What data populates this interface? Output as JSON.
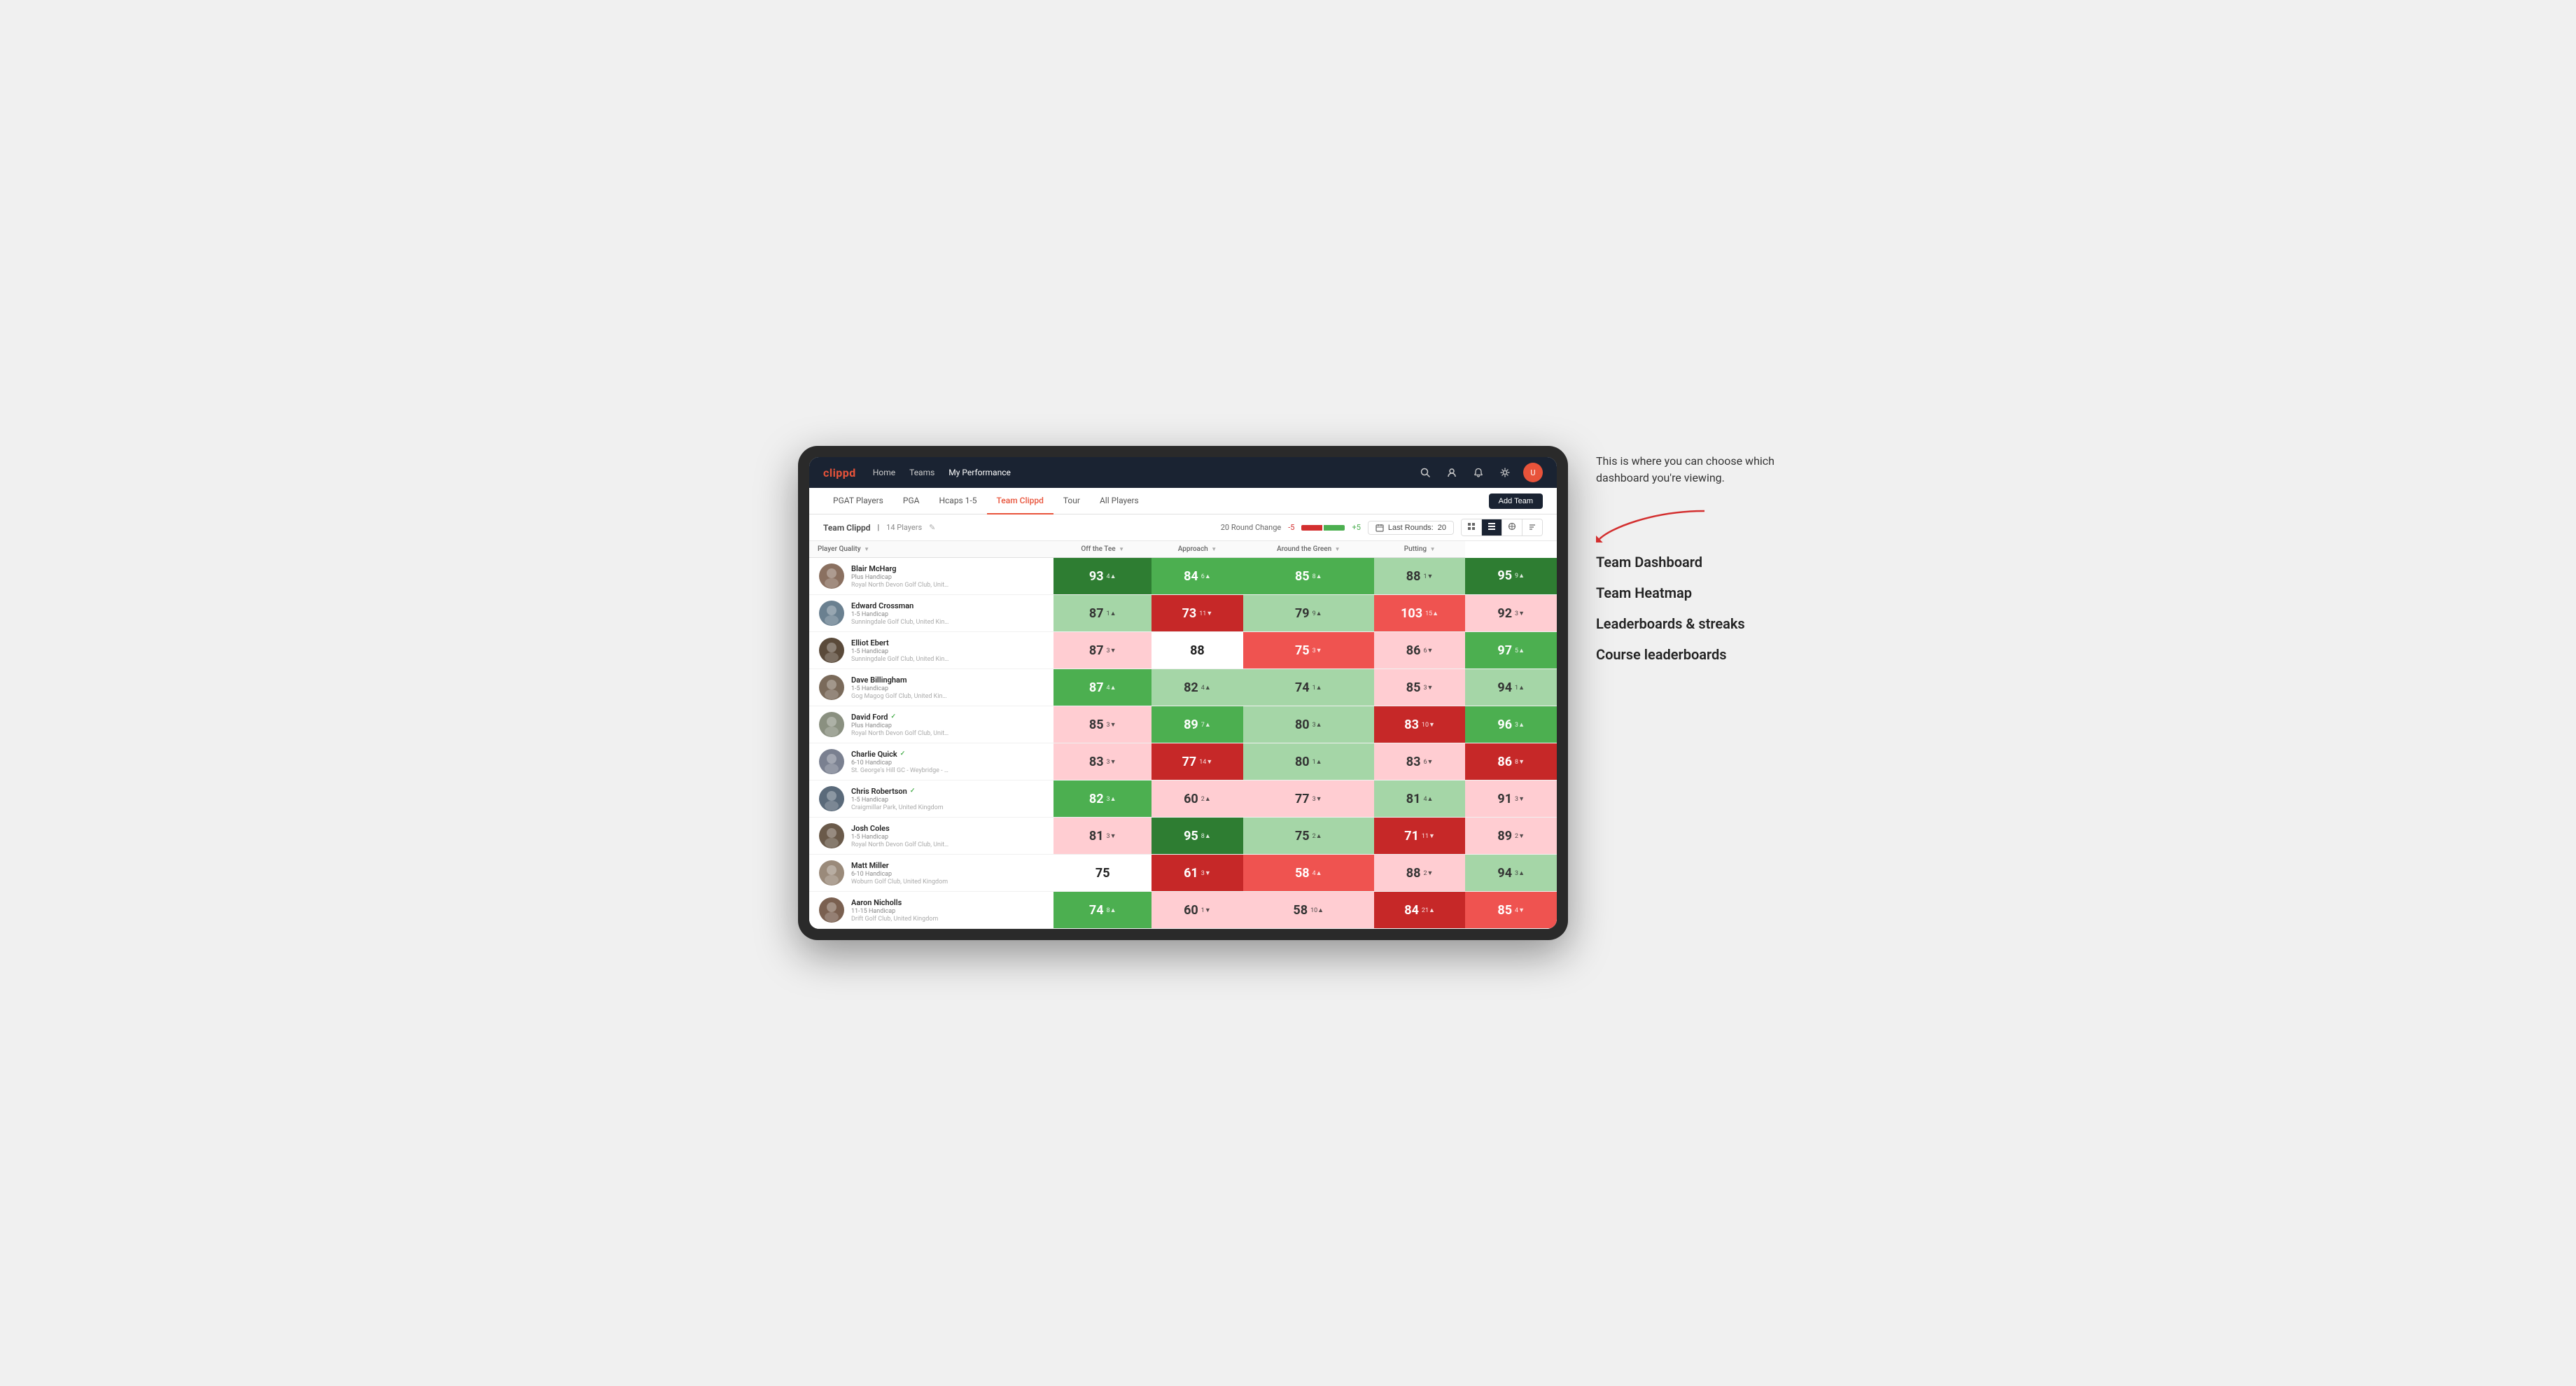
{
  "annotation": {
    "intro_text": "This is where you can choose which dashboard you're viewing.",
    "items": [
      {
        "label": "Team Dashboard"
      },
      {
        "label": "Team Heatmap"
      },
      {
        "label": "Leaderboards & streaks"
      },
      {
        "label": "Course leaderboards"
      }
    ]
  },
  "app": {
    "logo": "clippd",
    "nav": {
      "links": [
        {
          "label": "Home",
          "active": false
        },
        {
          "label": "Teams",
          "active": false
        },
        {
          "label": "My Performance",
          "active": true
        }
      ]
    },
    "sub_tabs": [
      {
        "label": "PGAT Players",
        "active": false
      },
      {
        "label": "PGA",
        "active": false
      },
      {
        "label": "Hcaps 1-5",
        "active": false
      },
      {
        "label": "Team Clippd",
        "active": true
      },
      {
        "label": "Tour",
        "active": false
      },
      {
        "label": "All Players",
        "active": false
      }
    ],
    "add_team_label": "Add Team"
  },
  "team_header": {
    "name": "Team Clippd",
    "player_count": "14 Players",
    "round_change_label": "20 Round Change",
    "round_change_value": "-5",
    "color_bar_label": "+5",
    "last_rounds_label": "Last Rounds:",
    "last_rounds_value": "20"
  },
  "table": {
    "columns": [
      {
        "label": "Player Quality",
        "sortable": true
      },
      {
        "label": "Off the Tee",
        "sortable": true
      },
      {
        "label": "Approach",
        "sortable": true
      },
      {
        "label": "Around the Green",
        "sortable": true
      },
      {
        "label": "Putting",
        "sortable": true
      }
    ],
    "players": [
      {
        "name": "Blair McHarg",
        "handicap": "Plus Handicap",
        "club": "Royal North Devon Golf Club, United Kingdom",
        "verified": false,
        "avatar_color": "#8a7060",
        "metrics": [
          {
            "value": "93",
            "change": "4",
            "dir": "up",
            "color": "green-dark"
          },
          {
            "value": "84",
            "change": "6",
            "dir": "up",
            "color": "green-mid"
          },
          {
            "value": "85",
            "change": "8",
            "dir": "up",
            "color": "green-mid"
          },
          {
            "value": "88",
            "change": "1",
            "dir": "down",
            "color": "green-light"
          },
          {
            "value": "95",
            "change": "9",
            "dir": "up",
            "color": "green-dark"
          }
        ]
      },
      {
        "name": "Edward Crossman",
        "handicap": "1-5 Handicap",
        "club": "Sunningdale Golf Club, United Kingdom",
        "verified": false,
        "avatar_color": "#6a8090",
        "metrics": [
          {
            "value": "87",
            "change": "1",
            "dir": "up",
            "color": "green-light"
          },
          {
            "value": "73",
            "change": "11",
            "dir": "down",
            "color": "red-dark"
          },
          {
            "value": "79",
            "change": "9",
            "dir": "up",
            "color": "green-light"
          },
          {
            "value": "103",
            "change": "15",
            "dir": "up",
            "color": "red-mid"
          },
          {
            "value": "92",
            "change": "3",
            "dir": "down",
            "color": "red-light"
          }
        ]
      },
      {
        "name": "Elliot Ebert",
        "handicap": "1-5 Handicap",
        "club": "Sunningdale Golf Club, United Kingdom",
        "verified": false,
        "avatar_color": "#5a4a3a",
        "metrics": [
          {
            "value": "87",
            "change": "3",
            "dir": "down",
            "color": "red-light"
          },
          {
            "value": "88",
            "change": "",
            "dir": "",
            "color": "white"
          },
          {
            "value": "75",
            "change": "3",
            "dir": "down",
            "color": "red-mid"
          },
          {
            "value": "86",
            "change": "6",
            "dir": "down",
            "color": "red-light"
          },
          {
            "value": "97",
            "change": "5",
            "dir": "up",
            "color": "green-mid"
          }
        ]
      },
      {
        "name": "Dave Billingham",
        "handicap": "1-5 Handicap",
        "club": "Gog Magog Golf Club, United Kingdom",
        "verified": false,
        "avatar_color": "#7a6a5a",
        "metrics": [
          {
            "value": "87",
            "change": "4",
            "dir": "up",
            "color": "green-mid"
          },
          {
            "value": "82",
            "change": "4",
            "dir": "up",
            "color": "green-light"
          },
          {
            "value": "74",
            "change": "1",
            "dir": "up",
            "color": "green-light"
          },
          {
            "value": "85",
            "change": "3",
            "dir": "down",
            "color": "red-light"
          },
          {
            "value": "94",
            "change": "1",
            "dir": "up",
            "color": "green-light"
          }
        ]
      },
      {
        "name": "David Ford",
        "handicap": "Plus Handicap",
        "club": "Royal North Devon Golf Club, United Kingdom",
        "verified": true,
        "avatar_color": "#8a9080",
        "metrics": [
          {
            "value": "85",
            "change": "3",
            "dir": "down",
            "color": "red-light"
          },
          {
            "value": "89",
            "change": "7",
            "dir": "up",
            "color": "green-mid"
          },
          {
            "value": "80",
            "change": "3",
            "dir": "up",
            "color": "green-light"
          },
          {
            "value": "83",
            "change": "10",
            "dir": "down",
            "color": "red-dark"
          },
          {
            "value": "96",
            "change": "3",
            "dir": "up",
            "color": "green-mid"
          }
        ]
      },
      {
        "name": "Charlie Quick",
        "handicap": "6-10 Handicap",
        "club": "St. George's Hill GC - Weybridge - Surrey, Uni...",
        "verified": true,
        "avatar_color": "#7a8090",
        "metrics": [
          {
            "value": "83",
            "change": "3",
            "dir": "down",
            "color": "red-light"
          },
          {
            "value": "77",
            "change": "14",
            "dir": "down",
            "color": "red-dark"
          },
          {
            "value": "80",
            "change": "1",
            "dir": "up",
            "color": "green-light"
          },
          {
            "value": "83",
            "change": "6",
            "dir": "down",
            "color": "red-light"
          },
          {
            "value": "86",
            "change": "8",
            "dir": "down",
            "color": "red-dark"
          }
        ]
      },
      {
        "name": "Chris Robertson",
        "handicap": "1-5 Handicap",
        "club": "Craigmillar Park, United Kingdom",
        "verified": true,
        "avatar_color": "#5a6a7a",
        "metrics": [
          {
            "value": "82",
            "change": "3",
            "dir": "up",
            "color": "green-mid"
          },
          {
            "value": "60",
            "change": "2",
            "dir": "up",
            "color": "red-light"
          },
          {
            "value": "77",
            "change": "3",
            "dir": "down",
            "color": "red-light"
          },
          {
            "value": "81",
            "change": "4",
            "dir": "up",
            "color": "green-light"
          },
          {
            "value": "91",
            "change": "3",
            "dir": "down",
            "color": "red-light"
          }
        ]
      },
      {
        "name": "Josh Coles",
        "handicap": "1-5 Handicap",
        "club": "Royal North Devon Golf Club, United Kingdom",
        "verified": false,
        "avatar_color": "#6a5a4a",
        "metrics": [
          {
            "value": "81",
            "change": "3",
            "dir": "down",
            "color": "red-light"
          },
          {
            "value": "95",
            "change": "8",
            "dir": "up",
            "color": "green-dark"
          },
          {
            "value": "75",
            "change": "2",
            "dir": "up",
            "color": "green-light"
          },
          {
            "value": "71",
            "change": "11",
            "dir": "down",
            "color": "red-dark"
          },
          {
            "value": "89",
            "change": "2",
            "dir": "down",
            "color": "red-light"
          }
        ]
      },
      {
        "name": "Matt Miller",
        "handicap": "6-10 Handicap",
        "club": "Woburn Golf Club, United Kingdom",
        "verified": false,
        "avatar_color": "#9a8a7a",
        "metrics": [
          {
            "value": "75",
            "change": "",
            "dir": "",
            "color": "white"
          },
          {
            "value": "61",
            "change": "3",
            "dir": "down",
            "color": "red-dark"
          },
          {
            "value": "58",
            "change": "4",
            "dir": "up",
            "color": "red-mid"
          },
          {
            "value": "88",
            "change": "2",
            "dir": "down",
            "color": "red-light"
          },
          {
            "value": "94",
            "change": "3",
            "dir": "up",
            "color": "green-light"
          }
        ]
      },
      {
        "name": "Aaron Nicholls",
        "handicap": "11-15 Handicap",
        "club": "Drift Golf Club, United Kingdom",
        "verified": false,
        "avatar_color": "#7a6050",
        "metrics": [
          {
            "value": "74",
            "change": "8",
            "dir": "up",
            "color": "green-mid"
          },
          {
            "value": "60",
            "change": "1",
            "dir": "down",
            "color": "red-light"
          },
          {
            "value": "58",
            "change": "10",
            "dir": "up",
            "color": "red-light"
          },
          {
            "value": "84",
            "change": "21",
            "dir": "up",
            "color": "red-dark"
          },
          {
            "value": "85",
            "change": "4",
            "dir": "down",
            "color": "red-mid"
          }
        ]
      }
    ]
  }
}
